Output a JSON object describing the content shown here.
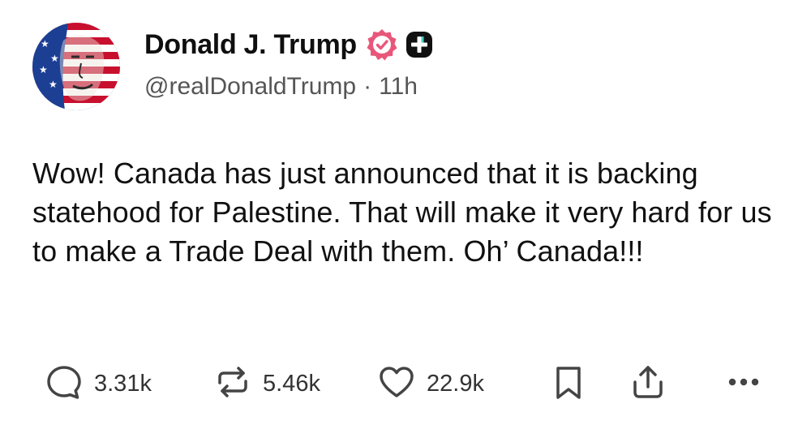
{
  "author": {
    "display_name": "Donald J. Trump",
    "handle": "@realDonaldTrump",
    "separator": "·",
    "time_ago": "11h",
    "verified_badge_icon": "verified-badge-icon",
    "plus_badge_icon": "plus-badge-icon"
  },
  "post": {
    "text": "Wow! Canada has just announced that it is backing statehood for Palestine. That will make it very hard for us to make a Trade Deal with them. Oh’ Canada!!!"
  },
  "actions": {
    "reply": {
      "icon": "comment-icon",
      "count": "3.31k"
    },
    "repost": {
      "icon": "repost-icon",
      "count": "5.46k"
    },
    "like": {
      "icon": "heart-icon",
      "count": "22.9k"
    },
    "bookmark": {
      "icon": "bookmark-icon"
    },
    "share": {
      "icon": "share-icon"
    },
    "more": {
      "icon": "more-icon"
    }
  },
  "colors": {
    "verified_badge": "#e8577a",
    "text_primary": "#111111",
    "text_secondary": "#555555",
    "icon": "#444444"
  }
}
